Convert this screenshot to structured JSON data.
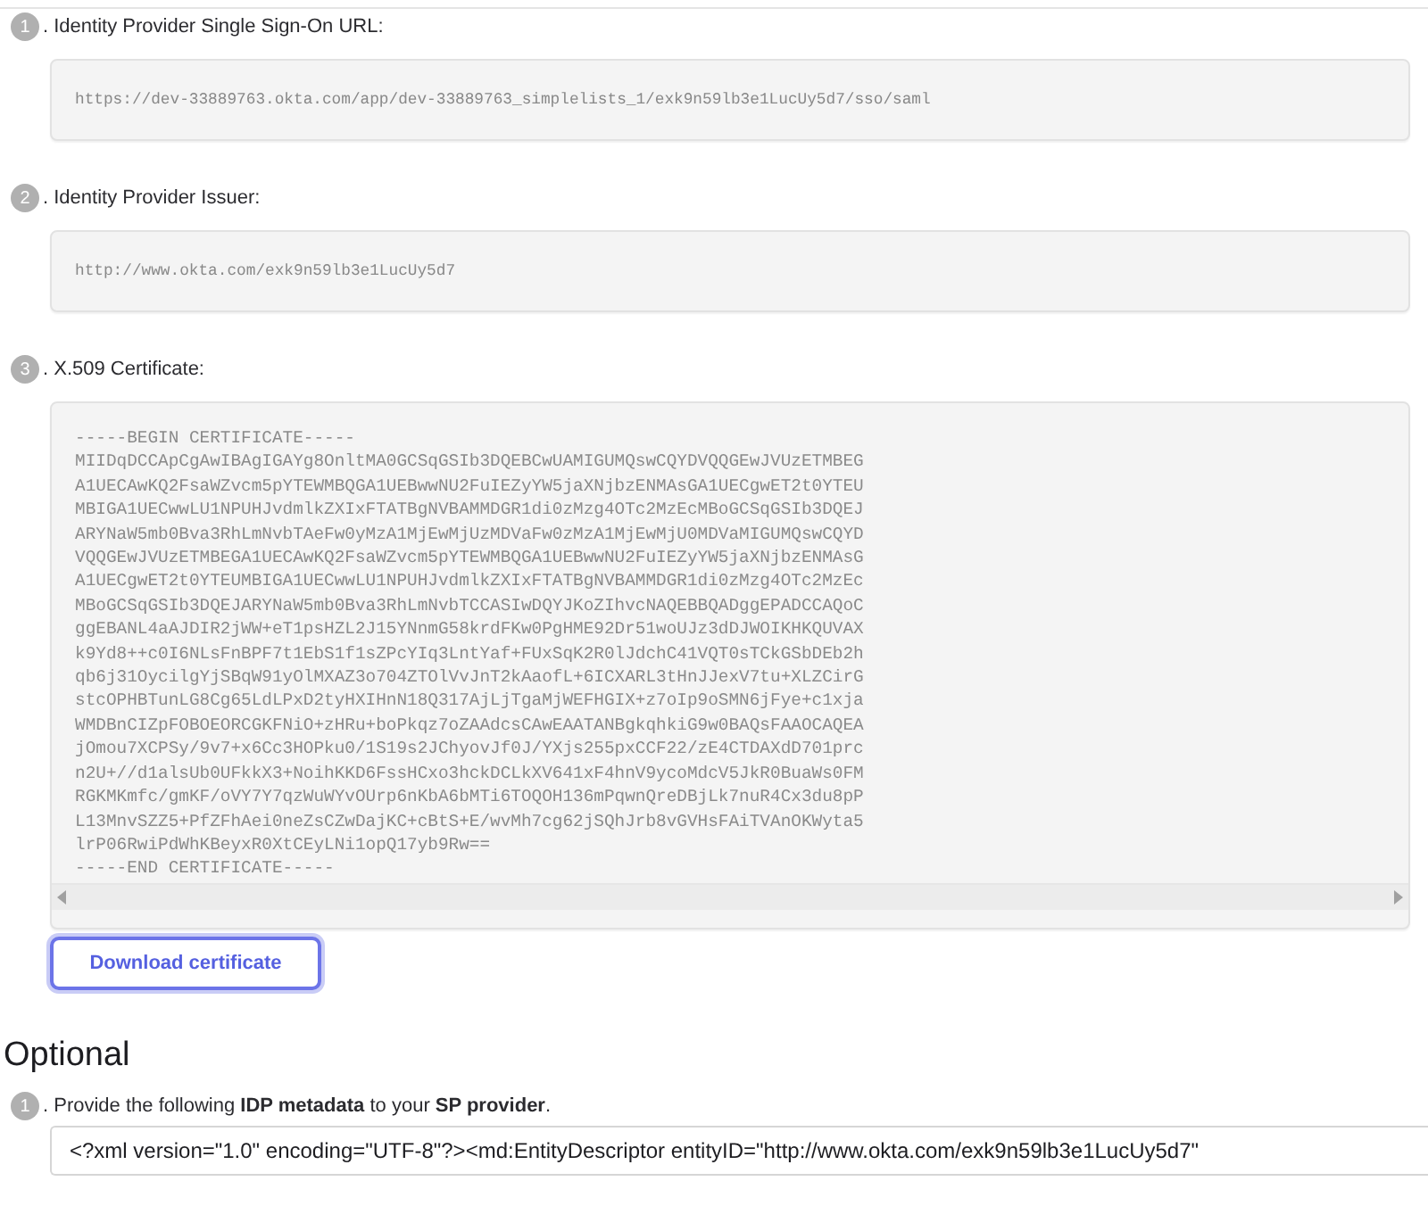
{
  "steps": [
    {
      "number": "1",
      "label": ". Identity Provider Single Sign-On URL:",
      "kind": "text",
      "lines": [
        "https://dev-33889763.okta.com/app/dev-33889763_simplelists_1/exk9n59lb3e1LucUy5d7/sso/saml"
      ]
    },
    {
      "number": "2",
      "label": ". Identity Provider Issuer:",
      "kind": "text",
      "lines": [
        "http://www.okta.com/exk9n59lb3e1LucUy5d7"
      ]
    },
    {
      "number": "3",
      "label": ". X.509 Certificate:",
      "kind": "certificate",
      "lines": [
        "-----BEGIN CERTIFICATE-----",
        "MIIDqDCCApCgAwIBAgIGAYg8OnltMA0GCSqGSIb3DQEBCwUAMIGUMQswCQYDVQQGEwJVUzETMBEG",
        "A1UECAwKQ2FsaWZvcm5pYTEWMBQGA1UEBwwNU2FuIEZyYW5jaXNjbzENMAsGA1UECgwET2t0YTEU",
        "MBIGA1UECwwLU1NPUHJvdmlkZXIxFTATBgNVBAMMDGR1di0zMzg4OTc2MzEcMBoGCSqGSIb3DQEJ",
        "ARYNaW5mb0Bva3RhLmNvbTAeFw0yMzA1MjEwMjUzMDVaFw0zMzA1MjEwMjU0MDVaMIGUMQswCQYD",
        "VQQGEwJVUzETMBEGA1UECAwKQ2FsaWZvcm5pYTEWMBQGA1UEBwwNU2FuIEZyYW5jaXNjbzENMAsG",
        "A1UECgwET2t0YTEUMBIGA1UECwwLU1NPUHJvdmlkZXIxFTATBgNVBAMMDGR1di0zMzg4OTc2MzEc",
        "MBoGCSqGSIb3DQEJARYNaW5mb0Bva3RhLmNvbTCCASIwDQYJKoZIhvcNAQEBBQADggEPADCCAQoC",
        "ggEBANL4aAJDIR2jWW+eT1psHZL2J15YNnmG58krdFKw0PgHME92Dr51woUJz3dDJWOIKHKQUVAX",
        "k9Yd8++c0I6NLsFnBPF7t1EbS1f1sZPcYIq3LntYaf+FUxSqK2R0lJdchC41VQT0sTCkGSbDEb2h",
        "qb6j31OycilgYjSBqW91yOlMXAZ3o704ZTOlVvJnT2kAaofL+6ICXARL3tHnJJexV7tu+XLZCirG",
        "stcOPHBTunLG8Cg65LdLPxD2tyHXIHnN18Q317AjLjTgaMjWEFHGIX+z7oIp9oSMN6jFye+c1xja",
        "WMDBnCIZpFOBOEORCGKFNiO+zHRu+boPkqz7oZAAdcsCAwEAATANBgkqhkiG9w0BAQsFAAOCAQEA",
        "jOmou7XCPSy/9v7+x6Cc3HOPku0/1S19s2JChyovJf0J/YXjs255pxCCF22/zE4CTDAXdD701prc",
        "n2U+//d1alsUb0UFkkX3+NoihKKD6FssHCxo3hckDCLkXV641xF4hnV9ycoMdcV5JkR0BuaWs0FM",
        "RGKMKmfc/gmKF/oVY7Y7qzWuWYvOUrp6nKbA6bMTi6TOQOH136mPqwnQreDBjLk7nuR4Cx3du8pP",
        "L13MnvSZZ5+PfZFhAei0neZsCZwDajKC+cBtS+E/wvMh7cg62jSQhJrb8vGVHsFAiTVAnOKWyta5",
        "lrP06RwiPdWhKBeyxR0XtCEyLNi1opQ17yb9Rw==",
        "-----END CERTIFICATE-----"
      ]
    }
  ],
  "download_button": "Download certificate",
  "optional": {
    "heading": "Optional",
    "steps": [
      {
        "number": "1",
        "text": ". Provide the following **IDP metadata** to your **SP provider**.",
        "value": "<?xml version=\"1.0\" encoding=\"UTF-8\"?><md:EntityDescriptor entityID=\"http://www.okta.com/exk9n59lb3e1LucUy5d7\""
      }
    ]
  }
}
